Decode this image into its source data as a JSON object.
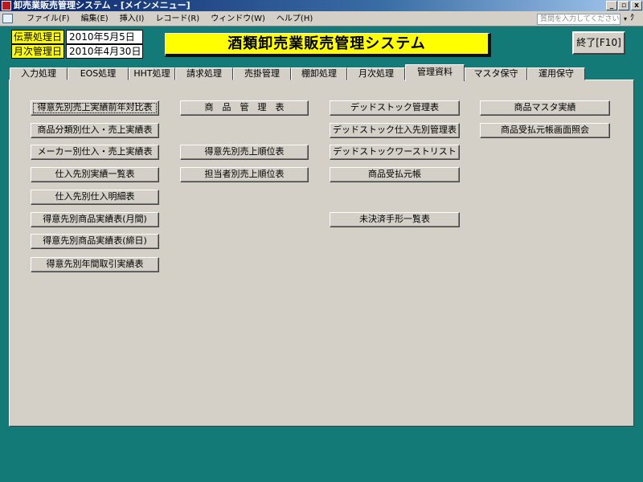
{
  "window": {
    "title": "卸売業販売管理システム - [メインメニュー]",
    "minimize_label": "_",
    "restore_label": "▫",
    "close_label": "x"
  },
  "menubar": {
    "items": [
      "ファイル(F)",
      "編集(E)",
      "挿入(I)",
      "レコード(R)",
      "ウィンドウ(W)",
      "ヘルプ(H)"
    ],
    "help_placeholder": "質問を入力してください",
    "dropdown_label": "▾",
    "doc_minimize_label": "ｰ",
    "doc_restore_label": "ｸ"
  },
  "header": {
    "slip_date_label": "伝票処理日",
    "slip_date_value": "2010年5月5日",
    "monthly_date_label": "月次管理日",
    "monthly_date_value": "2010年4月30日",
    "system_title": "酒類卸売業販売管理システム",
    "exit_label": "終了[F10]"
  },
  "tabs": [
    {
      "label": "入力処理",
      "active": false
    },
    {
      "label": "EOS処理",
      "active": false
    },
    {
      "label": "HHT処理",
      "active": false
    },
    {
      "label": "請求処理",
      "active": false
    },
    {
      "label": "売掛管理",
      "active": false
    },
    {
      "label": "棚卸処理",
      "active": false
    },
    {
      "label": "月次処理",
      "active": false
    },
    {
      "label": "管理資料",
      "active": true
    },
    {
      "label": "マスタ保守",
      "active": false
    },
    {
      "label": "運用保守",
      "active": false
    }
  ],
  "buttons": {
    "col1": [
      "得意先別売上実績前年対比表",
      "商品分類別仕入・売上実績表",
      "メーカー別仕入・売上実績表",
      "仕入先別実績一覧表",
      "仕入先別仕入明細表",
      "得意先別商品実績表(月間)",
      "得意先別商品実績表(締日)",
      "得意先別年間取引実績表"
    ],
    "col2": [
      "商　品　管　理　表",
      "得意先別売上順位表",
      "担当者別売上順位表"
    ],
    "col3": [
      "デッドストック管理表",
      "デッドストック仕入先別管理表",
      "デッドストックワーストリスト",
      "商品受払元帳",
      "未決済手形一覧表"
    ],
    "col4": [
      "商品マスタ実績",
      "商品受払元帳画面照会"
    ]
  }
}
